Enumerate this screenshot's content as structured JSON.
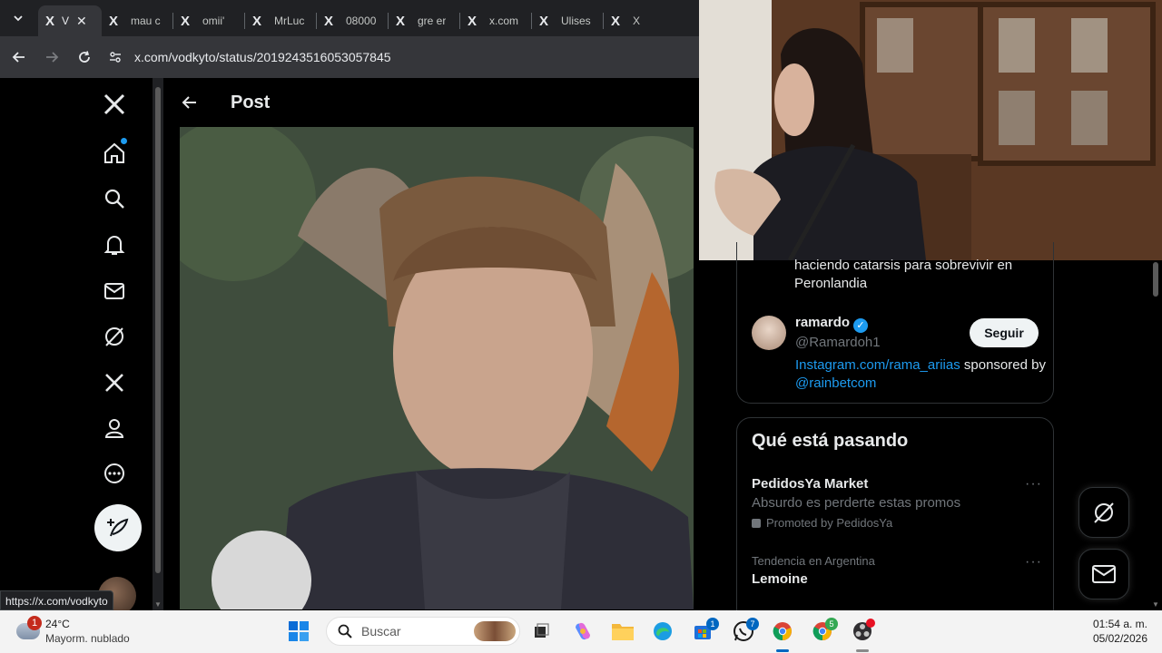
{
  "browser": {
    "tabs": [
      {
        "label": "V",
        "active": true
      },
      {
        "label": "mau c",
        "active": false
      },
      {
        "label": "omii'",
        "active": false
      },
      {
        "label": "MrLuc",
        "active": false
      },
      {
        "label": "08000",
        "active": false
      },
      {
        "label": "gre er",
        "active": false
      },
      {
        "label": "x.com",
        "active": false
      },
      {
        "label": "Ulises",
        "active": false
      },
      {
        "label": "X",
        "active": false
      }
    ],
    "tab_favicon": "X",
    "close_glyph": "✕",
    "url": "x.com/vodkyto/status/2019243516053057845",
    "hover_url": "https://x.com/vodkyto"
  },
  "post": {
    "title": "Post"
  },
  "right_column": {
    "tweet_text": "haciendo catarsis para sobrevivir en Peronlandia",
    "suggestion": {
      "name": "ramardo",
      "handle": "@Ramardoh1",
      "follow_label": "Seguir",
      "bio_link": "Instagram.com/rama_ariias",
      "bio_mid": " sponsored by ",
      "bio_mention": "@rainbetcom"
    },
    "trends": {
      "title": "Qué está pasando",
      "items": [
        {
          "name": "PedidosYa Market",
          "desc": "Absurdo es perderte estas promos",
          "promo": "Promoted by PedidosYa"
        },
        {
          "context": "Tendencia en Argentina",
          "name": "Lemoine"
        }
      ],
      "more": "···"
    }
  },
  "taskbar": {
    "temp": "24°C",
    "condition": "Mayorm. nublado",
    "weather_badge": "1",
    "search_placeholder": "Buscar",
    "store_badge": "1",
    "whatsapp_badge": "7",
    "chrome_badge": "5",
    "time": "01:54 a. m.",
    "date": "05/02/2026"
  },
  "colors": {
    "accent": "#1d9bf0",
    "background": "#000000",
    "muted": "#71767b"
  }
}
